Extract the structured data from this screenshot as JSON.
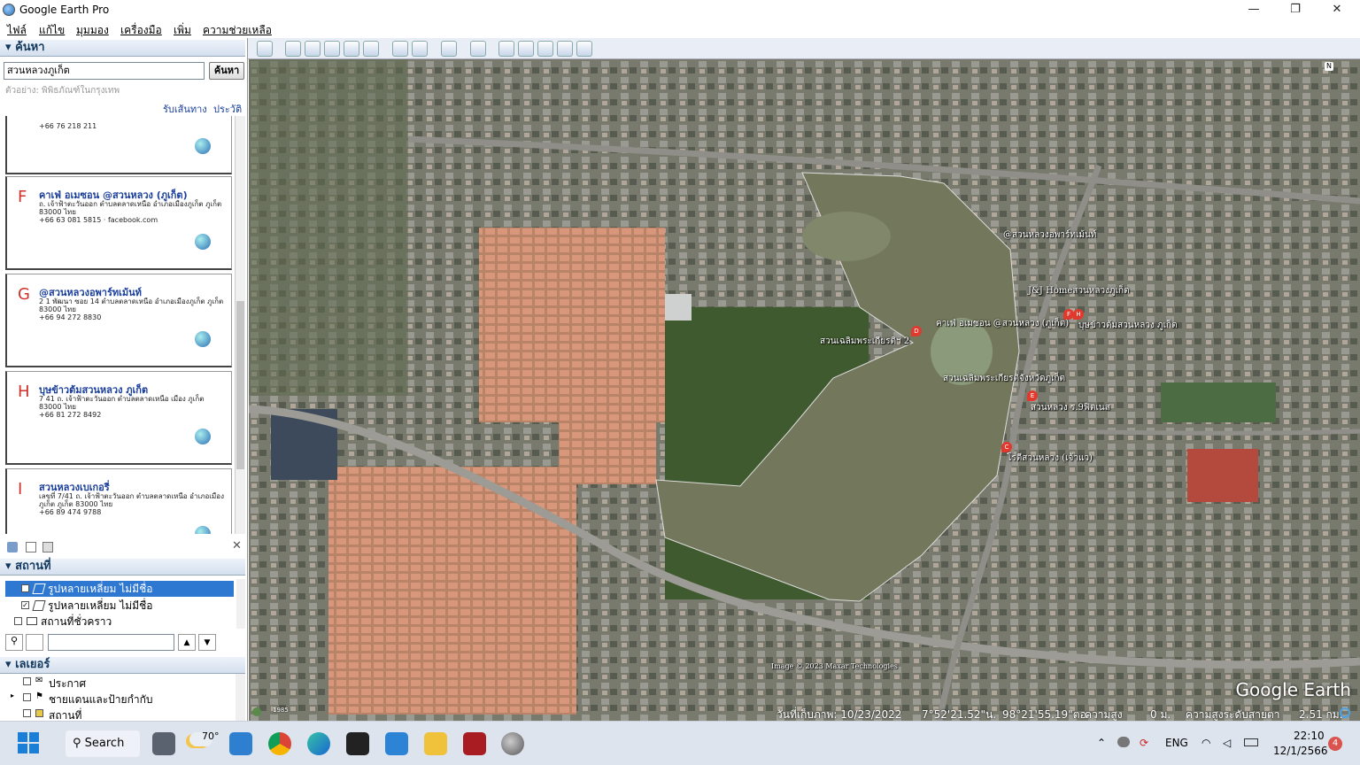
{
  "window": {
    "title": "Google Earth Pro",
    "minimize": "—",
    "maximize": "❐",
    "close": "✕"
  },
  "menu": [
    "ไฟล์",
    "แก้ไข",
    "มุมมอง",
    "เครื่องมือ",
    "เพิ่ม",
    "ความช่วยเหลือ"
  ],
  "search": {
    "header": "ค้นหา",
    "query": "สวนหลวงภูเก็ต",
    "button": "ค้นหา",
    "hint": "ตัวอย่าง: พิพิธภัณฑ์ในกรุงเทพ",
    "directions": "รับเส้นทาง",
    "history": "ประวัติ"
  },
  "results": [
    {
      "letter": "",
      "title": "",
      "addr": "+66 76 218 211",
      "web": ""
    },
    {
      "letter": "F",
      "title": "คาเฟ่ อเมซอน @สวนหลวง (ภูเก็ต)",
      "addr": "ถ. เจ้าฟ้าตะวันออก ตำบลตลาดเหนือ อำเภอเมืองภูเก็ต ภูเก็ต 83000 ไทย",
      "phone": "+66 63 081 5815 · facebook.com"
    },
    {
      "letter": "G",
      "title": "@สวนหลวงอพาร์ทเม้นท์",
      "addr": "2 1 พัฒนา ซอย 14 ตำบลตลาดเหนือ อำเภอเมืองภูเก็ต ภูเก็ต 83000 ไทย",
      "phone": "+66 94 272 8830"
    },
    {
      "letter": "H",
      "title": "บุษข้าวต้มสวนหลวง ภูเก็ต",
      "addr": "7 41 ถ. เจ้าฟ้าตะวันออก ตำบลตลาดเหนือ เมือง ภูเก็ต 83000 ไทย",
      "phone": "+66 81 272 8492"
    },
    {
      "letter": "I",
      "title": "สวนหลวงเบเกอรี่",
      "addr": "เลขที่ 7/41 ถ. เจ้าฟ้าตะวันออก ตำบลตลาดเหนือ อำเภอเมืองภูเก็ต ภูเก็ต 83000 ไทย",
      "phone": "+66 89 474 9788"
    }
  ],
  "places": {
    "header": "สถานที่",
    "rows": [
      "รูปหลายเหลี่ยม ไม่มีชื่อ",
      "รูปหลายเหลี่ยม ไม่มีชื่อ",
      "สถานที่ชั่วคราว"
    ]
  },
  "layers": {
    "header": "เลเยอร์",
    "rows": [
      "ประกาศ",
      "ชายแดนและป้ายกำกับ",
      "สถานที่"
    ]
  },
  "map": {
    "labels": [
      "@สวนหลวงอพาร์ทเม้นท์",
      "J&J Homeสวนหลวงภูเก็ต",
      "บุษข้าวต้มสวนหลวง ภูเก็ต",
      "คาเฟ่ อเมซอน @สวนหลวง (ภูเก็ต)",
      "สวนเฉลิมพระเกียรติฯ 2",
      "สวนเฉลิมพระเกียรติจังหวัดภูเก็ต",
      "สวนหลวง ร.9ฟิตเนส",
      "โรตีสวนหลวง (เจ้าแว)",
      "Image © 2023 Maxar Technologies"
    ],
    "pins": [
      "D",
      "F",
      "H",
      "E",
      "C"
    ],
    "logo": "Google Earth",
    "north": "N"
  },
  "status": {
    "year": "1985",
    "date_label": "วันที่เก็บภาพ: 10/23/2022",
    "lat": "7°52'21.52\"น.",
    "lon": "98°21'55.19\"ตอ.",
    "elev_label": "ความสูง",
    "elev": "0 ม.",
    "eye_label": "ความสูงระดับสายตา",
    "eye": "2.51 กม."
  },
  "taskbar": {
    "search": "Search",
    "weather": "70°",
    "lang": "ENG",
    "time": "22:10",
    "date": "12/1/2566",
    "notif": "4"
  }
}
